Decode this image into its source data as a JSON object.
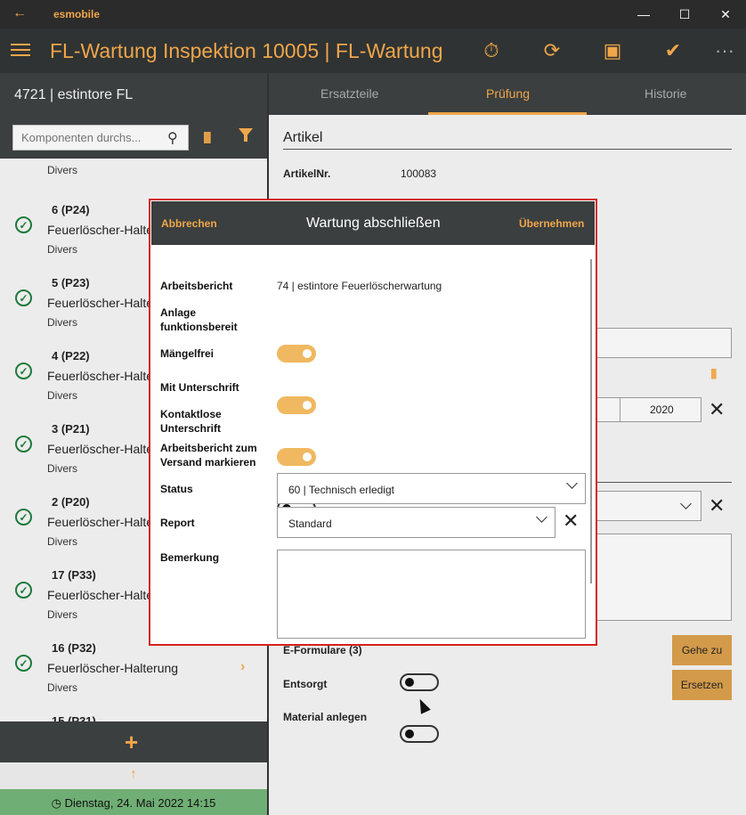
{
  "window": {
    "app_name": "esmobile",
    "back_icon": "arrow-left-icon"
  },
  "header": {
    "title": "FL-Wartung Inspektion 10005  |  FL-Wartung",
    "icons": [
      "menu-icon",
      "stopwatch-icon",
      "refresh-icon",
      "save-icon",
      "checkmark-icon",
      "more-icon"
    ]
  },
  "left": {
    "title": "4721  |  estintore FL",
    "search": {
      "placeholder": "Komponenten durchs..."
    },
    "partial_top_category": "Divers",
    "items": [
      {
        "code": "6 (P24)",
        "name": "Feuerlöscher-Halte",
        "category": "Divers"
      },
      {
        "code": "5 (P23)",
        "name": "Feuerlöscher-Halte",
        "category": "Divers"
      },
      {
        "code": "4 (P22)",
        "name": "Feuerlöscher-Halte",
        "category": "Divers"
      },
      {
        "code": "3 (P21)",
        "name": "Feuerlöscher-Halte",
        "category": "Divers"
      },
      {
        "code": "2 (P20)",
        "name": "Feuerlöscher-Halte",
        "category": "Divers"
      },
      {
        "code": "17 (P33)",
        "name": "Feuerlöscher-Halte",
        "category": "Divers"
      },
      {
        "code": "16 (P32)",
        "name": "Feuerlöscher-Halterung",
        "category": "Divers"
      },
      {
        "code": "15 (P31)",
        "name": "",
        "category": ""
      }
    ],
    "add_label": "+",
    "up_label": "↑",
    "status_date": "Dienstag, 24. Mai 2022 14:15"
  },
  "tabs": [
    "Ersatzteile",
    "Prüfung",
    "Historie"
  ],
  "active_tab": "Prüfung",
  "right": {
    "section_title": "Artikel",
    "artikel_label": "ArtikelNr.",
    "artikel_value": "100083",
    "year_value": "2020",
    "eform_label": "E-Formulare (3)",
    "goto_label": "Gehe zu",
    "replace_label": "Ersetzen",
    "entsorgt_label": "Entsorgt",
    "entsorgt_on": false,
    "material_label": "Material anlegen",
    "material_on": false
  },
  "dialog": {
    "cancel_label": "Abbrechen",
    "title": "Wartung abschließen",
    "apply_label": "Übernehmen",
    "fields": {
      "arbeitsbericht_label": "Arbeitsbericht",
      "arbeitsbericht_value": "74  |  estintore Feuerlöscherwartung",
      "anlage_label": "Anlage funktionsbereit",
      "anlage_on": true,
      "maengelfrei_label": "Mängelfrei",
      "maengelfrei_on": true,
      "unterschrift_label": "Mit Unterschrift",
      "unterschrift_on": true,
      "kontaktlos_label": "Kontaktlose Unterschrift",
      "kontaktlos_on": false,
      "versand_label": "Arbeitsbericht zum Versand markieren",
      "versand_on": true,
      "status_label": "Status",
      "status_value": "60  |  Technisch erledigt",
      "report_label": "Report",
      "report_value": "Standard",
      "bemerkung_label": "Bemerkung",
      "bemerkung_value": ""
    }
  },
  "colors": {
    "accent": "#f0a64a",
    "dark": "#2f3333",
    "panel": "#3b3f3f",
    "success": "#1d7a3a",
    "statusbar": "#6fae74",
    "dialog_border": "#d62020"
  }
}
